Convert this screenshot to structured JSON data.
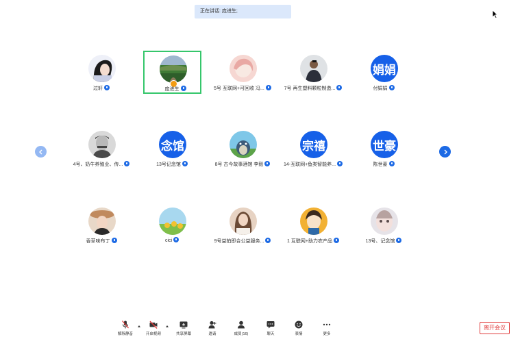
{
  "speaking": "正在讲话: 庞进生;",
  "participants": [
    {
      "name": "过轩",
      "type": "photo",
      "kind": "girl"
    },
    {
      "name": "庞进生",
      "type": "photo",
      "kind": "landscape",
      "active": true,
      "badge": true
    },
    {
      "name": "5号 互联网+可回收 冯...",
      "type": "photo",
      "kind": "pinkgirl"
    },
    {
      "name": "7号 再生塑料颗粒制造...",
      "type": "photo",
      "kind": "man"
    },
    {
      "name": "付娟娟",
      "type": "text",
      "text": "娟娟"
    },
    {
      "name": "4号、奶牛养殖业、传...",
      "type": "photo",
      "kind": "oldman"
    },
    {
      "name": "13号记念馆",
      "type": "text",
      "text": "念馆"
    },
    {
      "name": "8号 古今故事酒馆 李毅",
      "type": "photo",
      "kind": "totoro"
    },
    {
      "name": "14-互联网+鱼类智能养...",
      "type": "text",
      "text": "宗禧"
    },
    {
      "name": "陈世豪",
      "type": "text",
      "text": "世豪"
    },
    {
      "name": "香草味布丁",
      "type": "photo",
      "kind": "hatgirl"
    },
    {
      "name": "cici",
      "type": "photo",
      "kind": "sunflower"
    },
    {
      "name": "9号益拍即合公益服务...",
      "type": "photo",
      "kind": "woman"
    },
    {
      "name": "1 互联网+助力农产品",
      "type": "photo",
      "kind": "cartoon"
    },
    {
      "name": "13号、记念馆",
      "type": "photo",
      "kind": "doll"
    }
  ],
  "toolbar": {
    "mute": "解除静音",
    "video": "开启视频",
    "share": "共享屏幕",
    "invite": "邀请",
    "members": "成员(16)",
    "chat": "聊天",
    "emoji": "表情",
    "more": "更多"
  },
  "leave": "离开会议",
  "colors": {
    "accent": "#1d6ae5",
    "active_border": "#35c66b",
    "danger": "#e03a3a"
  }
}
